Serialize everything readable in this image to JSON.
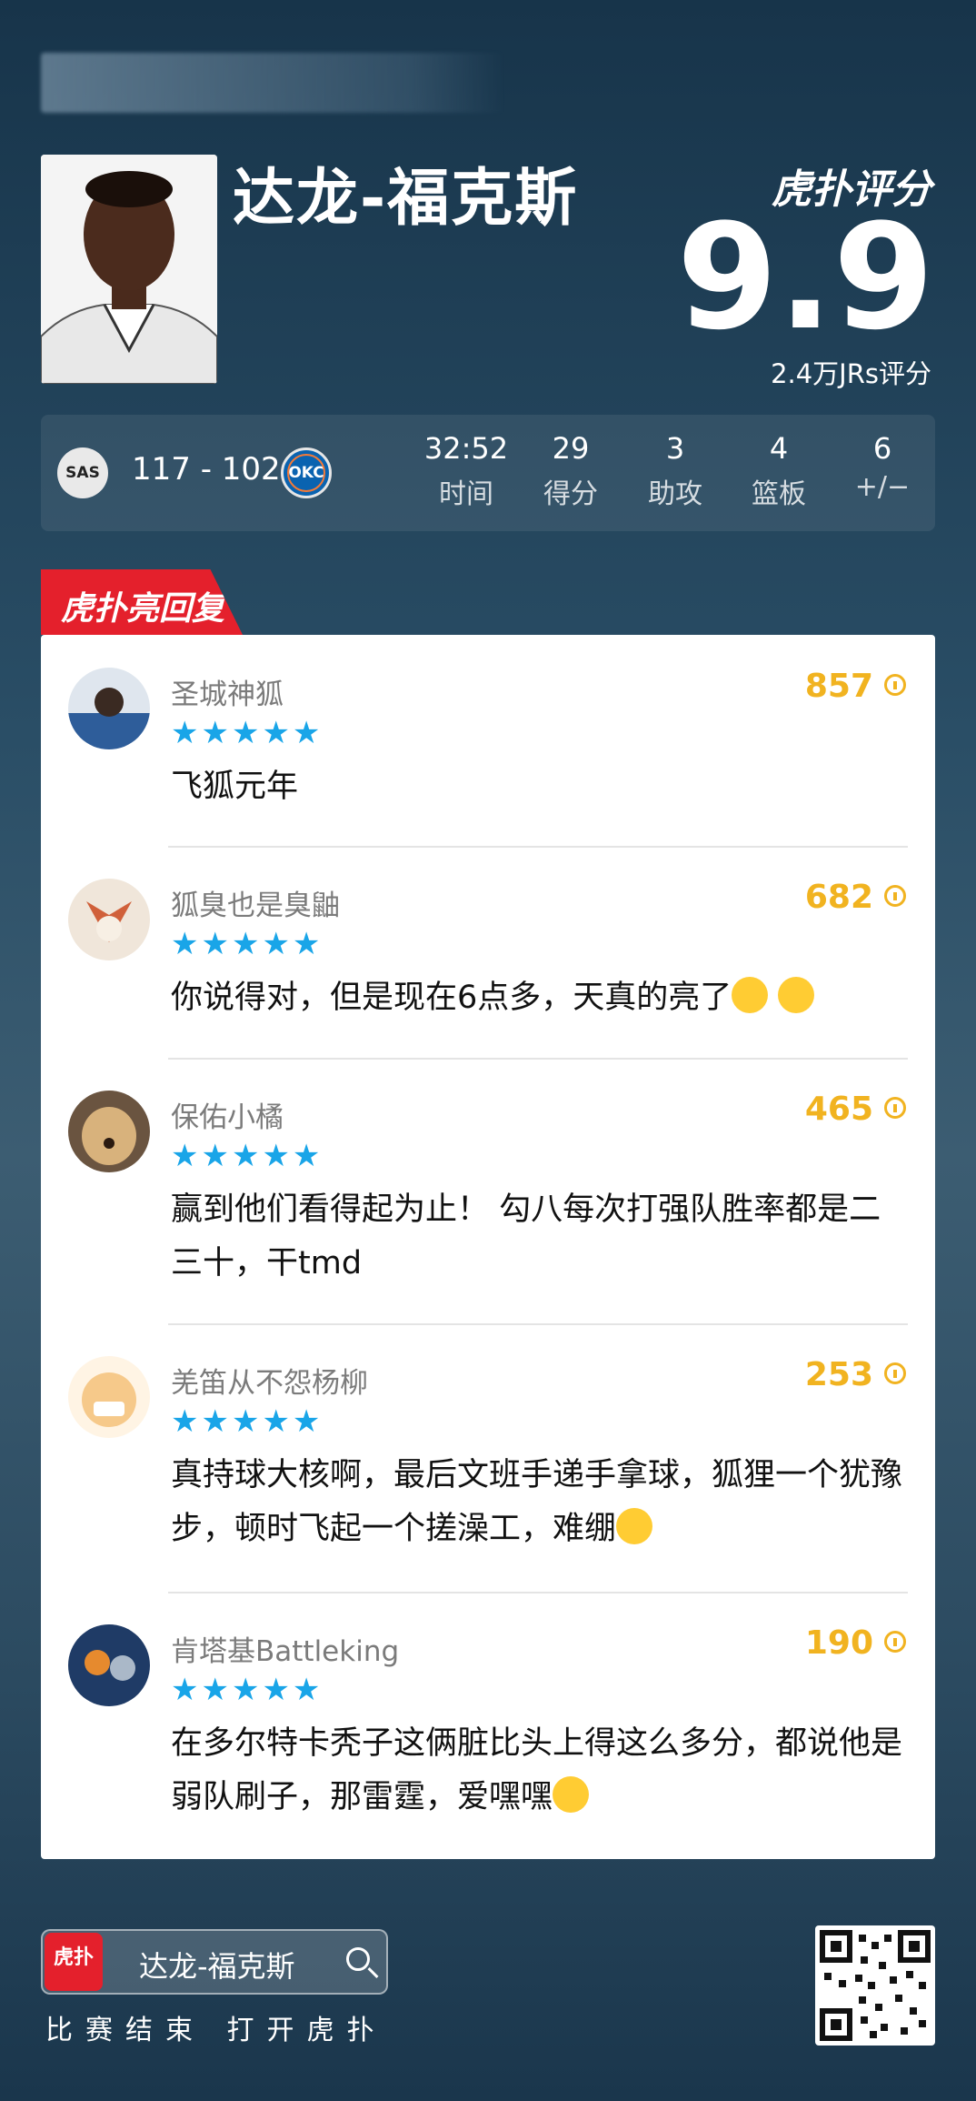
{
  "player": {
    "name": "达龙-福克斯"
  },
  "brand": {
    "score_label": "虎扑评分"
  },
  "rating": {
    "value": "9.9",
    "count_label": "2.4万JRs评分"
  },
  "game": {
    "home_team": "SAS",
    "away_team": "OKC",
    "score": "117 - 102",
    "stats": [
      {
        "value": "32:52",
        "label": "时间"
      },
      {
        "value": "29",
        "label": "得分"
      },
      {
        "value": "3",
        "label": "助攻"
      },
      {
        "value": "4",
        "label": "篮板"
      },
      {
        "value": "6",
        "label": "+/−"
      }
    ]
  },
  "section": {
    "badge": "虎扑亮回复"
  },
  "comments": [
    {
      "username": "圣城神狐",
      "stars": "★★★★★",
      "likes": "857",
      "text": "飞狐元年",
      "avatar_color": "#2e5d9a"
    },
    {
      "username": "狐臭也是臭鼬",
      "stars": "★★★★★",
      "likes": "682",
      "text": "你说得对，但是现在6点多，天真的亮了",
      "avatar_color": "#d0603a"
    },
    {
      "username": "保佑小橘",
      "stars": "★★★★★",
      "likes": "465",
      "text": "赢到他们看得起为止！ 勾八每次打强队胜率都是二三十，干tmd",
      "avatar_color": "#b89058"
    },
    {
      "username": "羌笛从不怨杨柳",
      "stars": "★★★★★",
      "likes": "253",
      "text": "真持球大核啊，最后文班手递手拿球，狐狸一个犹豫步，顿时飞起一个搓澡工，难绷",
      "avatar_color": "#f6c98a"
    },
    {
      "username": "肯塔基Battleking",
      "stars": "★★★★★",
      "likes": "190",
      "text": "在多尔特卡秃子这俩脏比头上得这么多分，都说他是弱队刷子，那雷霆，爱嘿嘿",
      "avatar_color": "#2f4f7a"
    }
  ],
  "footer": {
    "app_icon_text": "虎扑",
    "search_text": "达龙-福克斯",
    "cta": "比赛结束 打开虎扑"
  }
}
